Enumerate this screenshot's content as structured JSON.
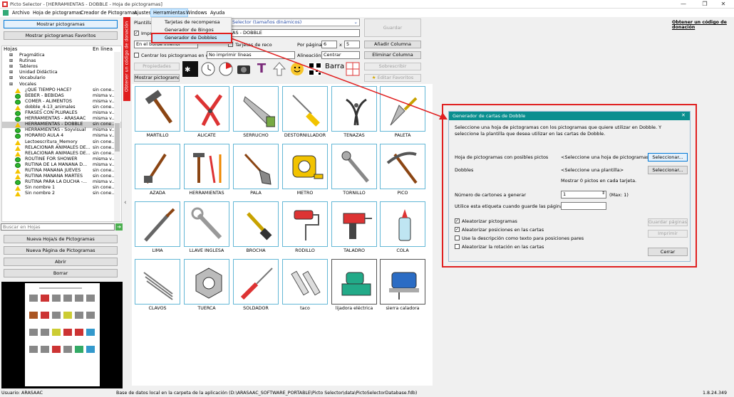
{
  "window": {
    "title": "Picto Selector - [HERRAMIENTAS - DOBBLE - Hoja de pictogramas]",
    "minimize_glyph": "—",
    "maximize_glyph": "❐",
    "close_glyph": "✕"
  },
  "menu": {
    "archivo": "Archivo",
    "hoja": "Hoja de pictogramas",
    "creador": "Creador de Pictogramas",
    "ajustes": "Ajustes",
    "herramientas": "Herramientas",
    "windows": "Windows",
    "ayuda": "Ayuda"
  },
  "herramientas_menu": {
    "items": [
      "Tarjetas de recompensa",
      "Generador de Bingos",
      "Generador de Dobbles"
    ]
  },
  "left_panel": {
    "show_pictos": "Mostrar pictogramas",
    "show_favs": "Mostrar pictogramas Favoritos",
    "col_hojas": "Hojas",
    "col_enlinea": "En línea",
    "search_placeholder": "Buscar en Hojas",
    "btn_new_sheet": "Nueva Hoja/s de Pictogramas",
    "btn_new_page": "Nueva Página de Pictogramas",
    "btn_open": "Abrir",
    "btn_delete": "Borrar",
    "folders": [
      "Pragmática",
      "Rutinas",
      "Tableros",
      "Unidad Didáctica",
      "Vocabulario",
      "Vocales"
    ],
    "sheets": [
      {
        "name": "¿QUÉ TIEMPO HACE?",
        "status": "sin cone...",
        "icon": "warn"
      },
      {
        "name": "BEBER - BEBIDAS",
        "status": "misma v...",
        "icon": "ok"
      },
      {
        "name": "COMER - ALIMENTOS",
        "status": "misma v...",
        "icon": "ok"
      },
      {
        "name": "dobble_4-13_animales",
        "status": "sin cone...",
        "icon": "warn"
      },
      {
        "name": "FRASES CON PLURALES",
        "status": "misma v...",
        "icon": "ok"
      },
      {
        "name": "HERRAMIENTAS - ARASAAC",
        "status": "misma v...",
        "icon": "ok"
      },
      {
        "name": "HERRAMIENTAS - DOBBLE",
        "status": "sin cone...",
        "icon": "warn"
      },
      {
        "name": "HERRAMIENTAS - Soyvisual",
        "status": "misma v...",
        "icon": "ok"
      },
      {
        "name": "HORARIO AULA 4",
        "status": "misma v...",
        "icon": "ok"
      },
      {
        "name": "Lectoescritura_Memory",
        "status": "sin cone...",
        "icon": "warn"
      },
      {
        "name": "RELACIONAR ANIMALES DE...",
        "status": "sin cone...",
        "icon": "warn"
      },
      {
        "name": "RELACIONAR ANIMALES DE...",
        "status": "sin cone...",
        "icon": "warn"
      },
      {
        "name": "ROUTINE FOR SHOWER",
        "status": "misma v...",
        "icon": "ok"
      },
      {
        "name": "RUTINA DE LA MAÑANA D...",
        "status": "misma v...",
        "icon": "ok"
      },
      {
        "name": "RUTINA MAÑANA JUEVES",
        "status": "sin cone...",
        "icon": "warn"
      },
      {
        "name": "RUTINA MAÑANA MARTES",
        "status": "sin cone...",
        "icon": "warn"
      },
      {
        "name": "RUTINA PARA LA DUCHA -...",
        "status": "misma v...",
        "icon": "ok"
      },
      {
        "name": "Sin nombre 1",
        "status": "sin cone...",
        "icon": "warn"
      },
      {
        "name": "Sin nombre 2",
        "status": "sin cone...",
        "icon": "warn"
      }
    ]
  },
  "vertical_banner": "Obtener un código de donación",
  "top": {
    "plantilla_label": "Plantilla:",
    "plantilla_value": "Selector (tamaños dinámicos)",
    "imprimir_label": "Imprimir",
    "title_value": "AS - DOBBLE",
    "guardar": "Guardar",
    "donation_link": "Obtener un código de donación",
    "borde_label": "En el borde inferior",
    "tarjetas_label": "Tarjetas de reco",
    "por_pagina_label": "Por página",
    "por_pagina_cols": "6",
    "por_pagina_x": "x",
    "por_pagina_rows": "5",
    "add_col": "Añadir Columna",
    "centrar_label": "Centrar los pictogramas en cada",
    "no_imprimir": "No imprimir líneas",
    "alineacion_label": "Alineación",
    "alineacion_value": "Centrar",
    "del_col": "Eliminar Columna",
    "propiedades": "Propiedades",
    "sobrescribir": "Sobrescribir",
    "mostrar_pictos": "Mostrar pictogramas",
    "editar_fav": "Editar Favoritos",
    "tool_text": "T",
    "tool_barra": "Barra"
  },
  "pictos": [
    {
      "label": "MARTILLO",
      "icon": "hammer-icon"
    },
    {
      "label": "ALICATE",
      "icon": "pliers-icon"
    },
    {
      "label": "SERRUCHO",
      "icon": "saw-icon"
    },
    {
      "label": "DESTORNILLADOR",
      "icon": "screwdriver-icon"
    },
    {
      "label": "TENAZAS",
      "icon": "pincers-icon"
    },
    {
      "label": "PALETA",
      "icon": "trowel-icon"
    },
    {
      "label": "AZADA",
      "icon": "hoe-icon"
    },
    {
      "label": "HERRAMIENTAS",
      "icon": "tools-icon"
    },
    {
      "label": "PALA",
      "icon": "shovel-icon"
    },
    {
      "label": "METRO",
      "icon": "tape-measure-icon"
    },
    {
      "label": "TORNILLO",
      "icon": "screw-icon"
    },
    {
      "label": "PICO",
      "icon": "pickaxe-icon"
    },
    {
      "label": "LIMA",
      "icon": "file-icon"
    },
    {
      "label": "LLAVE INGLESA",
      "icon": "wrench-icon"
    },
    {
      "label": "BROCHA",
      "icon": "brush-icon"
    },
    {
      "label": "RODILLO",
      "icon": "roller-icon"
    },
    {
      "label": "TALADRO",
      "icon": "drill-icon"
    },
    {
      "label": "COLA",
      "icon": "glue-icon"
    },
    {
      "label": "CLAVOS",
      "icon": "nails-icon"
    },
    {
      "label": "TUERCA",
      "icon": "nut-icon"
    },
    {
      "label": "SOLDADOR",
      "icon": "soldering-iron-icon"
    },
    {
      "label": "taco",
      "icon": "wall-plug-icon"
    },
    {
      "label": "lijadora eléctrica",
      "icon": "sander-icon"
    },
    {
      "label": "sierra caladora",
      "icon": "jigsaw-icon"
    }
  ],
  "dialog": {
    "title": "Generador de cartas de Dobble",
    "close": "✕",
    "intro": "Seleccione una hoja de pictogramas con los pictogramas que quiere utilizar en Dobble. Y seleccione la plantilla que desea utilizar en las cartas de Dobble.",
    "hoja_label": "Hoja de pictogramas con posibles pictos",
    "hoja_value": "<Seleccione una hoja de pictogramas>",
    "select1": "Seleccionar...",
    "dobbles_label": "Dobbles",
    "dobbles_value": "<Seleccione una plantilla>",
    "select2": "Seleccionar...",
    "mostrar_info": "Mostrar 0 pictos en cada tarjeta.",
    "num_label": "Número de cartones a generar",
    "num_value": "1",
    "max_label": "(Max: 1)",
    "etiqueta_label": "Utilice esta etiqueta cuando guarde las páginas",
    "etiqueta_value": "",
    "chk1": "Aleatorizar pictogramas",
    "chk2": "Aleatorizar posiciones en las cartas",
    "chk3": "Use la descripción como texto para posiciones pares",
    "chk4": "Aleatorizar la rotación en las cartas",
    "guardar_paginas": "Guardar páginas",
    "imprimir": "Imprimir",
    "cerrar": "Cerrar",
    "checked": [
      true,
      true,
      false,
      false
    ]
  },
  "status": {
    "user": "Usuario: ARASAAC",
    "db": "Base de datos local en la carpeta de la aplicación (D:\\ARASAAC_SOFTWARE_PORTABLE\\Picto Selector\\data\\PictoSelectorDatabase.fdb)",
    "version": "1.8.24.349"
  },
  "colors": {
    "accent_red": "#e02020",
    "card_border": "#63b7d6",
    "dialog_header": "#0a8f8f"
  }
}
